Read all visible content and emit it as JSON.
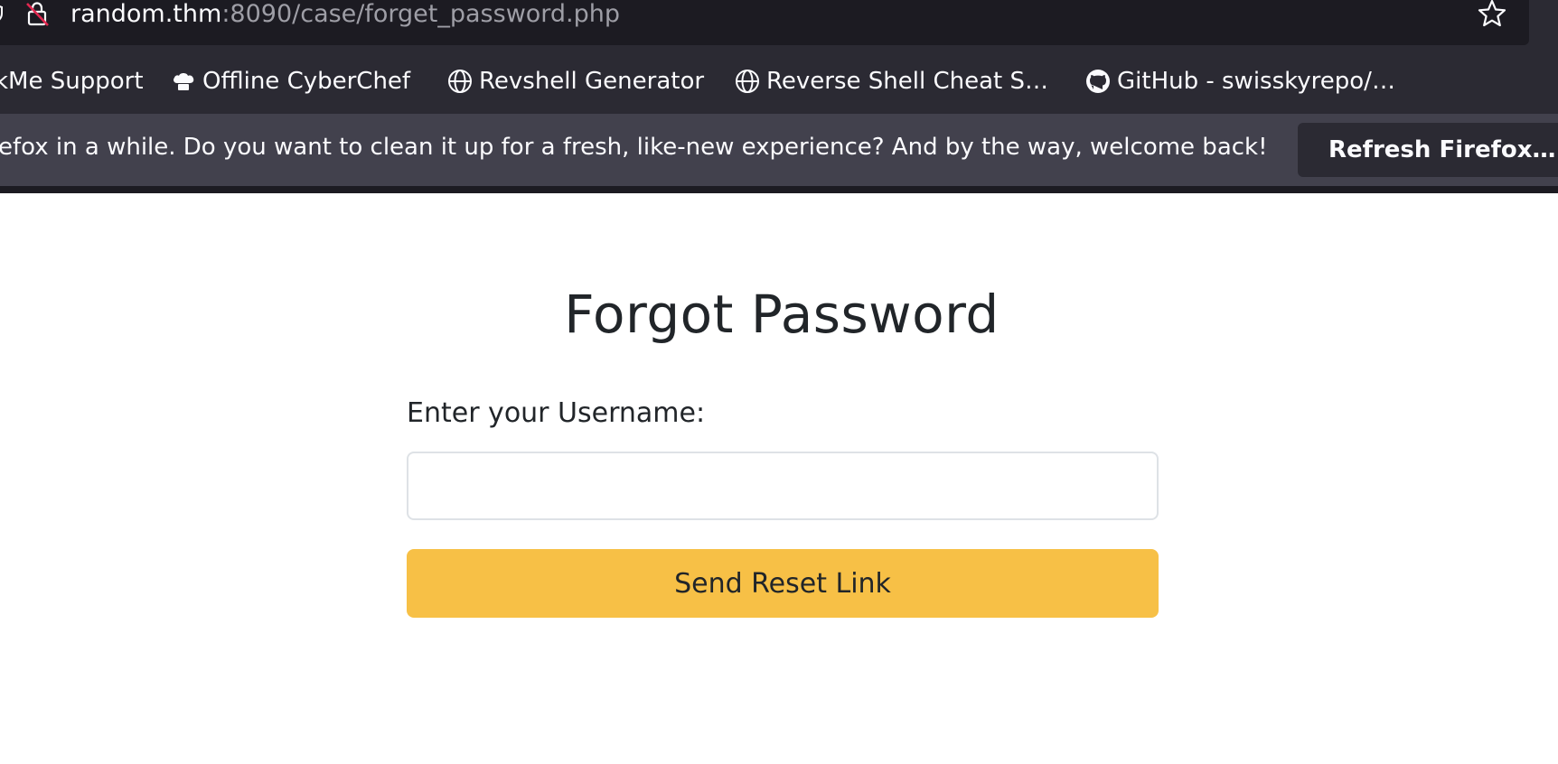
{
  "browser": {
    "url": {
      "host": "random.thm",
      "path": ":8090/case/forget_password.php"
    },
    "bookmarks": [
      {
        "label": "kMe Support",
        "icon": "none"
      },
      {
        "label": "Offline CyberChef",
        "icon": "chef-hat-icon"
      },
      {
        "label": "Revshell Generator",
        "icon": "globe-icon"
      },
      {
        "label": "Reverse Shell Cheat S…",
        "icon": "globe-icon"
      },
      {
        "label": "GitHub - swisskyrepo/…",
        "icon": "github-icon"
      }
    ],
    "notification": {
      "message": "efox in a while. Do you want to clean it up for a fresh, like-new experience? And by the way, welcome back!",
      "button_label": "Refresh Firefox…"
    },
    "colors": {
      "chrome_bg": "#2b2a33",
      "urlbar_bg": "#1c1b22",
      "notification_bg": "#42414d"
    }
  },
  "page": {
    "title": "Forgot Password",
    "form": {
      "label": "Enter your Username:",
      "input_value": "",
      "submit_label": "Send Reset Link"
    },
    "colors": {
      "button_bg": "#f7c046",
      "text": "#212529",
      "input_border": "#dee2e6"
    }
  }
}
